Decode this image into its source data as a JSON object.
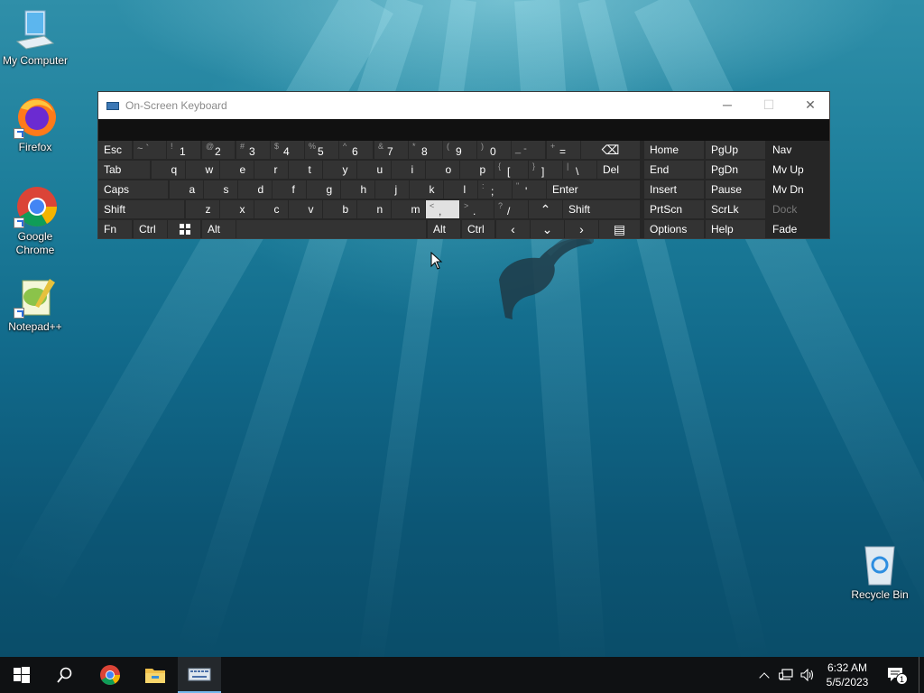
{
  "desktop_icons": [
    {
      "label": "My Computer",
      "icon": "computer-icon"
    },
    {
      "label": "Firefox",
      "icon": "firefox-icon"
    },
    {
      "label": "Google Chrome",
      "icon": "chrome-icon"
    },
    {
      "label": "Notepad++",
      "icon": "notepadpp-icon"
    },
    {
      "label": "Recycle Bin",
      "icon": "recycle-bin-icon"
    }
  ],
  "osk": {
    "title": "On-Screen Keyboard",
    "title_icon": "keyboard-icon",
    "minimize": "─",
    "maximize": "☐",
    "close": "✕",
    "keys": {
      "esc": "Esc",
      "backtick_s": "~ `",
      "n1_s": "!",
      "n1": "1",
      "n2_s": "@",
      "n2": "2",
      "n3_s": "#",
      "n3": "3",
      "n4_s": "$",
      "n4": "4",
      "n5_s": "%",
      "n5": "5",
      "n6_s": "^",
      "n6": "6",
      "n7_s": "&",
      "n7": "7",
      "n8_s": "*",
      "n8": "8",
      "n9_s": "(",
      "n9": "9",
      "n0_s": ")",
      "n0": "0",
      "minus": "_ -",
      "plus_s": "+",
      "equals": "=",
      "backspace": "⌫",
      "tab": "Tab",
      "q": "q",
      "w": "w",
      "e": "e",
      "r": "r",
      "t": "t",
      "y": "y",
      "u": "u",
      "i": "i",
      "o": "o",
      "p": "p",
      "lbrace_s": "{",
      "lbracket": "[",
      "rbrace_s": "}",
      "rbracket": "]",
      "pipe_s": "|",
      "backslash": "\\",
      "del": "Del",
      "caps": "Caps",
      "a": "a",
      "s": "s",
      "d": "d",
      "f": "f",
      "g": "g",
      "h": "h",
      "j": "j",
      "k": "k",
      "l": "l",
      "colon_s": ":",
      "semicolon": ";",
      "quote_s": "\"",
      "apos": "'",
      "enter": "Enter",
      "shift": "Shift",
      "z": "z",
      "x": "x",
      "c": "c",
      "v": "v",
      "b": "b",
      "n": "n",
      "m": "m",
      "lt_s": "<",
      "comma": ",",
      "gt_s": ">",
      "period": ".",
      "qmark_s": "?",
      "slash": "/",
      "up": "⌃",
      "shift_r": "Shift",
      "fn": "Fn",
      "ctrl": "Ctrl",
      "win": "win-logo",
      "alt": "Alt",
      "alt_r": "Alt",
      "ctrl_r": "Ctrl",
      "left": "‹",
      "down": "⌄",
      "right": "›",
      "menu": "▤",
      "home": "Home",
      "pgup": "PgUp",
      "nav": "Nav",
      "end": "End",
      "pgdn": "PgDn",
      "mvup": "Mv Up",
      "insert": "Insert",
      "pause": "Pause",
      "mvdn": "Mv Dn",
      "prtscn": "PrtScn",
      "scrlk": "ScrLk",
      "dock": "Dock",
      "options": "Options",
      "help": "Help",
      "fade": "Fade"
    }
  },
  "taskbar": {
    "time": "6:32 AM",
    "date": "5/5/2023",
    "notification_count": "1",
    "buttons": [
      "start-icon",
      "search-icon",
      "chrome-taskbar-icon",
      "file-explorer-icon",
      "osk-taskbar-icon"
    ]
  }
}
